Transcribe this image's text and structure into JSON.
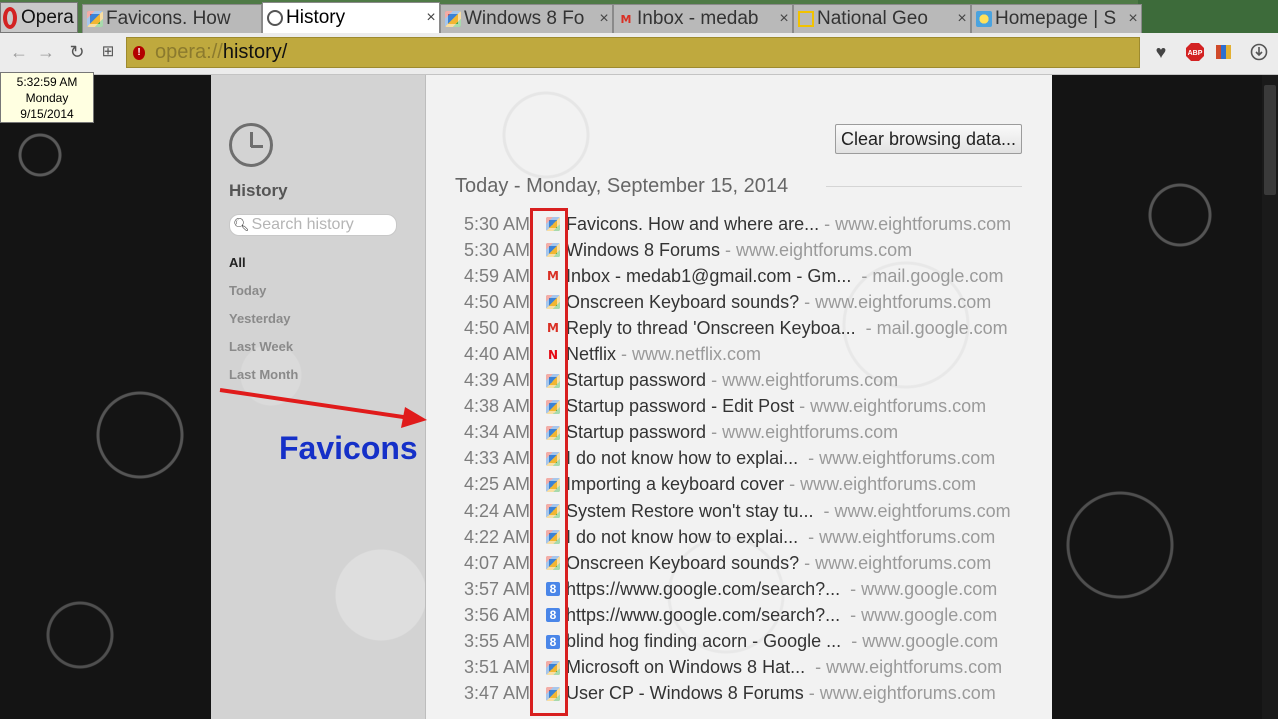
{
  "browser": {
    "menu_label": "Opera",
    "tabs": [
      {
        "title": "Favicons. How",
        "favicon": "eightforums-favicon",
        "active": false
      },
      {
        "title": "History",
        "favicon": "history-clock-favicon",
        "active": true
      },
      {
        "title": "Windows 8 Fo",
        "favicon": "eightforums-favicon",
        "active": false
      },
      {
        "title": "Inbox - medab",
        "favicon": "gmail-favicon",
        "active": false
      },
      {
        "title": "National Geo",
        "favicon": "natgeo-favicon",
        "active": false
      },
      {
        "title": "Homepage | S",
        "favicon": "homepage-favicon",
        "active": false
      }
    ],
    "tab_close_glyph": "×",
    "address": {
      "scheme": "opera://",
      "path": "history/"
    }
  },
  "toolbar_icons": [
    "back-icon",
    "forward-icon",
    "reload-icon",
    "speed-dial-icon",
    "heart-icon",
    "adblock-icon",
    "bookmarks-icon",
    "download-icon"
  ],
  "clock": {
    "time": "5:32:59 AM",
    "day": "Monday",
    "date": "9/15/2014"
  },
  "sidebar": {
    "title": "History",
    "search_placeholder": "Search history",
    "filters": [
      "All",
      "Today",
      "Yesterday",
      "Last Week",
      "Last Month"
    ],
    "selected_filter": "All"
  },
  "main": {
    "clear_button": "Clear browsing data...",
    "date_heading": "Today - Monday, September 15, 2014",
    "entries": [
      {
        "time": "5:30 AM",
        "title": "Favicons. How and where are...",
        "sep": " - ",
        "domain": "www.eightforums.com",
        "favicon": "eightforums"
      },
      {
        "time": "5:30 AM",
        "title": "Windows 8 Forums",
        "sep": " - ",
        "domain": "www.eightforums.com",
        "favicon": "eightforums"
      },
      {
        "time": "4:59 AM",
        "title": "Inbox - medab1@gmail.com - Gm...",
        "sep": "  - ",
        "domain": "mail.google.com",
        "favicon": "gmail"
      },
      {
        "time": "4:50 AM",
        "title": "Onscreen Keyboard sounds?",
        "sep": " - ",
        "domain": "www.eightforums.com",
        "favicon": "eightforums"
      },
      {
        "time": "4:50 AM",
        "title": "Reply to thread 'Onscreen Keyboa...",
        "sep": "  - ",
        "domain": "mail.google.com",
        "favicon": "gmail"
      },
      {
        "time": "4:40 AM",
        "title": "Netflix",
        "sep": " - ",
        "domain": "www.netflix.com",
        "favicon": "netflix"
      },
      {
        "time": "4:39 AM",
        "title": "Startup password",
        "sep": " - ",
        "domain": "www.eightforums.com",
        "favicon": "eightforums"
      },
      {
        "time": "4:38 AM",
        "title": "Startup password - Edit Post",
        "sep": " - ",
        "domain": "www.eightforums.com",
        "favicon": "eightforums"
      },
      {
        "time": "4:34 AM",
        "title": "Startup password",
        "sep": " - ",
        "domain": "www.eightforums.com",
        "favicon": "eightforums"
      },
      {
        "time": "4:33 AM",
        "title": "I do not know how to explai...",
        "sep": "  - ",
        "domain": "www.eightforums.com",
        "favicon": "eightforums"
      },
      {
        "time": "4:25 AM",
        "title": "Importing a keyboard cover",
        "sep": " - ",
        "domain": "www.eightforums.com",
        "favicon": "eightforums"
      },
      {
        "time": "4:24 AM",
        "title": "System Restore won't stay tu...",
        "sep": "  - ",
        "domain": "www.eightforums.com",
        "favicon": "eightforums"
      },
      {
        "time": "4:22 AM",
        "title": "I do not know how to explai...",
        "sep": "  - ",
        "domain": "www.eightforums.com",
        "favicon": "eightforums"
      },
      {
        "time": "4:07 AM",
        "title": "Onscreen Keyboard sounds?",
        "sep": " - ",
        "domain": "www.eightforums.com",
        "favicon": "eightforums"
      },
      {
        "time": "3:57 AM",
        "title": "https://www.google.com/search?...",
        "sep": "  - ",
        "domain": "www.google.com",
        "favicon": "google"
      },
      {
        "time": "3:56 AM",
        "title": "https://www.google.com/search?...",
        "sep": "  - ",
        "domain": "www.google.com",
        "favicon": "google"
      },
      {
        "time": "3:55 AM",
        "title": "blind hog finding acorn - Google ...",
        "sep": "  - ",
        "domain": "www.google.com",
        "favicon": "google"
      },
      {
        "time": "3:51 AM",
        "title": "Microsoft on Windows 8 Hat...",
        "sep": "  - ",
        "domain": "www.eightforums.com",
        "favicon": "eightforums"
      },
      {
        "time": "3:47 AM",
        "title": "User CP - Windows 8 Forums",
        "sep": " - ",
        "domain": "www.eightforums.com",
        "favicon": "eightforums"
      }
    ]
  },
  "annotation": {
    "label": "Favicons",
    "color": "#1530c8",
    "highlight_color": "#d81f1f"
  }
}
